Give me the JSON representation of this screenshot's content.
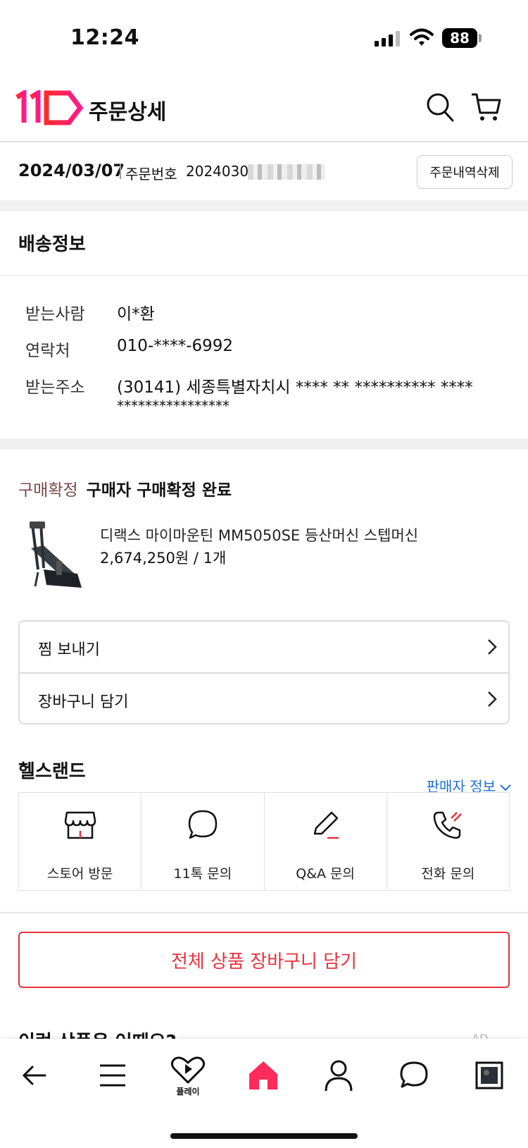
{
  "status_bar": {
    "time": "12:24",
    "battery": "88"
  },
  "header": {
    "title": "주문상세"
  },
  "order": {
    "date": "2024/03/07",
    "number_label": "주문번호",
    "number": "20240307",
    "delete_label": "주문내역삭제"
  },
  "shipping": {
    "title": "배송정보",
    "recipient_label": "받는사람",
    "recipient": "이*환",
    "contact_label": "연락처",
    "contact": "010-****-6992",
    "address_label": "받는주소",
    "address_line1": "(30141) 세종특별자치시 **** ** ********** ****",
    "address_line2": "****************"
  },
  "purchase": {
    "status": "구매확정",
    "status_desc": "구매자 구매확정 완료",
    "product_name": "디랙스 마이마운틴 MM5050SE 등산머신 스텝머신",
    "price_qty": "2,674,250원 / 1개"
  },
  "actions": {
    "wish": "찜 보내기",
    "cart": "장바구니 담기"
  },
  "seller": {
    "name": "헬스랜드",
    "info_label": "판매자 정보",
    "tiles": [
      "스토어 방문",
      "11톡 문의",
      "Q&A 문의",
      "전화 문의"
    ]
  },
  "all_cart_button": "전체 상품 장바구니 담기",
  "recommend": {
    "title": "이런 상품은 어때요?",
    "ad": "AD"
  },
  "tabbar": {
    "play_label": "플레이"
  },
  "colors": {
    "brand_red": "#e8323c",
    "link_blue": "#1e6fd9",
    "status_brown": "#7a4a4a"
  }
}
